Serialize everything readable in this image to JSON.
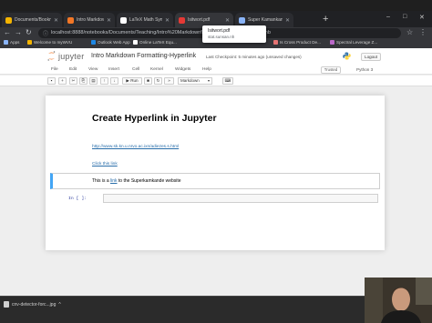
{
  "browser": {
    "tabs": [
      {
        "label": "Documents/Bookm",
        "favicon_color": "#f4b400",
        "active": false
      },
      {
        "label": "Intro Markdown",
        "favicon_color": "#f37726",
        "active": false
      },
      {
        "label": "LaTeX Math Sym",
        "favicon_color": "#ffffff",
        "active": false
      },
      {
        "label": "Isitwort.pdf",
        "favicon_color": "#e53935",
        "active": true
      },
      {
        "label": "Super Kamankandi",
        "favicon_color": "#8ab4f8",
        "active": false
      }
    ],
    "new_tab": "+",
    "window_controls": [
      "–",
      "□",
      "✕"
    ],
    "url": "localhost:8888/notebooks/Documents/Teaching/Intro%20Markdown%20Formatting-Hyperlink.ipynb",
    "popup": {
      "title": "Isitwort.pdf",
      "domain": "stat.sunsan.nh"
    },
    "bookmarks": [
      "Apps",
      "Welcome to myWVU",
      "Outlook Web App",
      "Online LaTeX Equ...",
      "Is Cross Product De...",
      "Spectral Leverage Z..."
    ]
  },
  "jupyter": {
    "logo_text": "jupyter",
    "notebook_title": "Intro Markdown Formatting-Hyperlink",
    "checkpoint": "Last Checkpoint: 5 minutes ago  (unsaved changes)",
    "logout": "Logout",
    "menus": [
      "File",
      "Edit",
      "View",
      "Insert",
      "Cell",
      "Kernel",
      "Widgets",
      "Help"
    ],
    "trusted": "Trusted",
    "kernel": "Python 3",
    "toolbar": {
      "run_label": "Run",
      "cell_type": "Markdown"
    },
    "cells": {
      "heading": "Create Hyperlink in Jupyter",
      "plain_link": "http://www.sk.kn.u.nrvo.ac.ixn/adiezes.s.html",
      "click_link": "Click this link",
      "selected_before": "This is a ",
      "selected_link": "link",
      "selected_after": " to the Superkamkande website",
      "prompt": "In [ ]:"
    }
  },
  "taskbar": {
    "download_name": "cnv-detector-forc...jpg"
  }
}
